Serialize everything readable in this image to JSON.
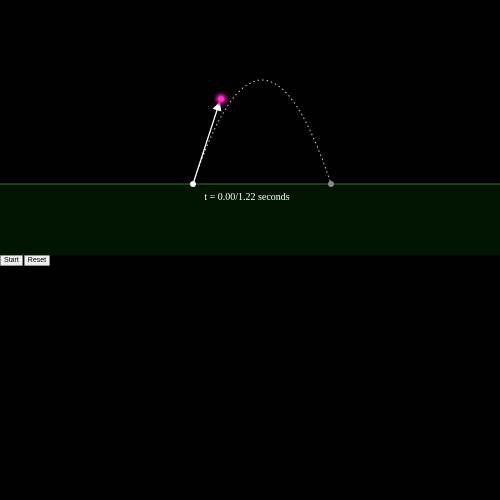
{
  "simulation": {
    "time_label_prefix": "t = ",
    "current_time": "0.00",
    "total_time": "1.22",
    "time_unit": "seconds",
    "time_readout": "t = 0.00/1.22 seconds",
    "progress": 0.0
  },
  "controls": {
    "start_label": "Start",
    "reset_label": "Reset"
  },
  "colors": {
    "background": "#000000",
    "ground_fill": "#001400",
    "ground_line": "#2a7a2a",
    "trajectory": "#cfcfcf",
    "velocity_arrow": "#ffffff",
    "projectile": "#ff33cc",
    "launch_point": "#ffffff",
    "landing_point": "#8a8a8a"
  }
}
